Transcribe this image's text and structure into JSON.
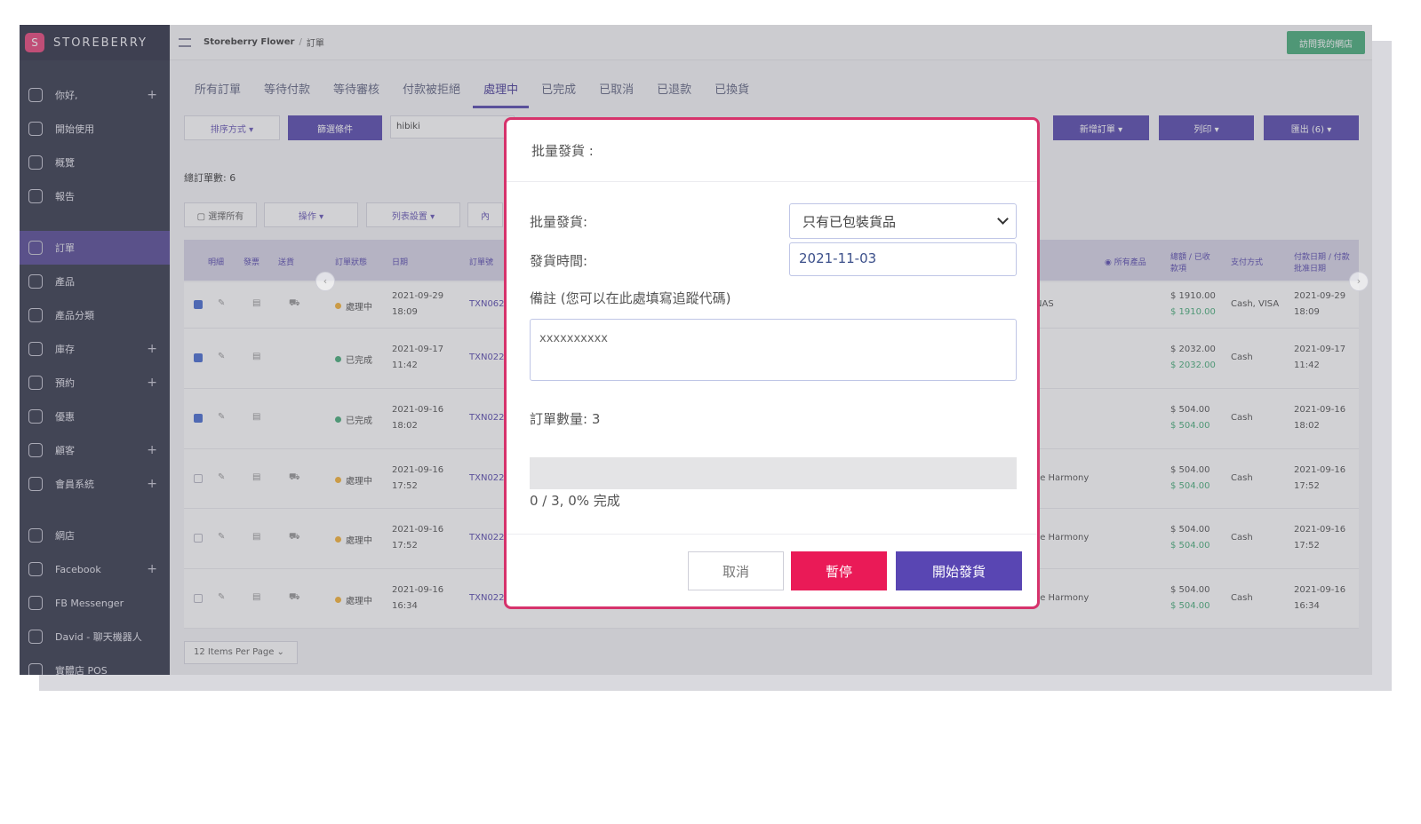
{
  "brand": {
    "logo": "S",
    "name": "STOREBERRY"
  },
  "sidebar": {
    "items": [
      {
        "label": "你好,",
        "plus": "+"
      },
      {
        "label": "開始使用",
        "plus": ""
      },
      {
        "label": "概覽",
        "plus": ""
      },
      {
        "label": "報告",
        "plus": ""
      },
      {
        "label": "訂單",
        "plus": ""
      },
      {
        "label": "產品",
        "plus": ""
      },
      {
        "label": "產品分類",
        "plus": ""
      },
      {
        "label": "庫存",
        "plus": "+"
      },
      {
        "label": "預約",
        "plus": "+"
      },
      {
        "label": "優惠",
        "plus": ""
      },
      {
        "label": "顧客",
        "plus": "+"
      },
      {
        "label": "會員系統",
        "plus": "+"
      },
      {
        "label": "網店",
        "plus": ""
      },
      {
        "label": "Facebook",
        "plus": "+"
      },
      {
        "label": "FB Messenger",
        "plus": ""
      },
      {
        "label": "David - 聊天機器人",
        "plus": ""
      },
      {
        "label": "實體店 POS",
        "plus": ""
      }
    ]
  },
  "topbar": {
    "store": "Storeberry Flower",
    "separator": "/",
    "page": "訂單",
    "visit_label": "訪問我的網店"
  },
  "tabs": [
    "所有訂單",
    "等待付款",
    "等待審核",
    "付款被拒絕",
    "處理中",
    "已完成",
    "已取消",
    "已退款",
    "已換貨"
  ],
  "toolbar": {
    "sort": "排序方式 ▾",
    "filter": "篩選條件",
    "search_value": "hibiki",
    "new_order": "新增訂單 ▾",
    "print": "列印 ▾",
    "export": "匯出 (6) ▾"
  },
  "summary": {
    "total_orders": "總訂單數: 6"
  },
  "bulk": {
    "select_all": "▢ 選擇所有",
    "actions": "操作 ▾",
    "columns": "列表設置 ▾",
    "more": "內"
  },
  "table": {
    "headers": [
      "明細",
      "發票",
      "送貨",
      "訂單狀態",
      "日期",
      "訂單號",
      "◉ 所有產品",
      "總額 / 已收款項",
      "支付方式",
      "付款日期 / 付款批准日期"
    ],
    "rows": [
      {
        "checked": true,
        "status": "處理中",
        "status_color": "#f5b43c",
        "date": "2021-09-29",
        "time": "18:09",
        "order": "TXN062",
        "product": "NAS",
        "total": "$ 1910.00",
        "paid": "$ 1910.00",
        "method": "Cash, VISA",
        "pay_date": "2021-09-29",
        "pay_time": "18:09",
        "truck": true
      },
      {
        "checked": true,
        "status": "已完成",
        "status_color": "#4caf7d",
        "date": "2021-09-17",
        "time": "11:42",
        "order": "TXN022",
        "product": "",
        "total": "$ 2032.00",
        "paid": "$ 2032.00",
        "method": "Cash",
        "pay_date": "2021-09-17",
        "pay_time": "11:42",
        "truck": false
      },
      {
        "checked": true,
        "status": "已完成",
        "status_color": "#4caf7d",
        "date": "2021-09-16",
        "time": "18:02",
        "order": "TXN022",
        "product": "",
        "total": "$ 504.00",
        "paid": "$ 504.00",
        "method": "Cash",
        "pay_date": "2021-09-16",
        "pay_time": "18:02",
        "truck": false
      },
      {
        "checked": false,
        "status": "處理中",
        "status_color": "#f5b43c",
        "date": "2021-09-16",
        "time": "17:52",
        "order": "TXN022",
        "product": "se Harmony",
        "total": "$ 504.00",
        "paid": "$ 504.00",
        "method": "Cash",
        "pay_date": "2021-09-16",
        "pay_time": "17:52",
        "truck": true
      },
      {
        "checked": false,
        "status": "處理中",
        "status_color": "#f5b43c",
        "date": "2021-09-16",
        "time": "17:52",
        "order": "TXN022",
        "product": "se Harmony",
        "total": "$ 504.00",
        "paid": "$ 504.00",
        "method": "Cash",
        "pay_date": "2021-09-16",
        "pay_time": "17:52",
        "truck": true
      },
      {
        "checked": false,
        "status": "處理中",
        "status_color": "#f5b43c",
        "date": "2021-09-16",
        "time": "16:34",
        "order": "TXN022",
        "product": "se Harmony",
        "total": "$ 504.00",
        "paid": "$ 504.00",
        "method": "Cash",
        "pay_date": "2021-09-16",
        "pay_time": "16:34",
        "truck": true
      }
    ]
  },
  "pager": {
    "label": "12 Items Per Page ⌄"
  },
  "modal": {
    "title": "批量發貨 :",
    "ship_label": "批量發貨:",
    "ship_select": "只有已包裝貨品",
    "time_label": "發貨時間:",
    "time_value": "2021-11-03",
    "note_label": "備註 (您可以在此處填寫追蹤代碼)",
    "note_value": "xxxxxxxxxx",
    "count_label": "訂單數量: 3",
    "progress_fraction": 0,
    "progress_text": "0 / 3, 0% 完成",
    "cancel": "取消",
    "pause": "暫停",
    "start": "開始發貨"
  },
  "colors": {
    "accent": "#5b4db0",
    "danger": "#ea1a57",
    "modal_border": "#d6336c",
    "success": "#4caf7d"
  }
}
